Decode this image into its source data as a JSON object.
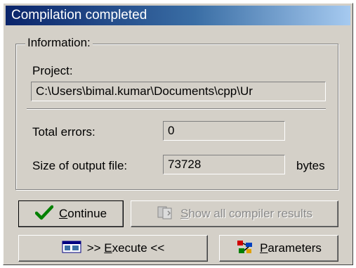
{
  "window": {
    "title": "Compilation completed"
  },
  "info": {
    "group_label": "Information:",
    "project_label": "Project:",
    "project_path": "C:\\Users\\bimal.kumar\\Documents\\cpp\\Ur",
    "errors_label": "Total errors:",
    "errors_value": "0",
    "size_label": "Size of output file:",
    "size_value": "73728",
    "size_unit": "bytes"
  },
  "buttons": {
    "continue": {
      "mnemonic": "C",
      "rest": "ontinue",
      "icon": "checkmark-icon",
      "color": "#008000"
    },
    "show_results": {
      "mnemonic": "S",
      "rest": "how all compiler results",
      "icon": "documents-icon"
    },
    "execute": {
      "prefix": ">> ",
      "mnemonic": "E",
      "rest": "xecute <<",
      "icon": "run-window-icon"
    },
    "parameters": {
      "mnemonic": "P",
      "rest": "arameters",
      "icon": "parameters-icon"
    }
  }
}
